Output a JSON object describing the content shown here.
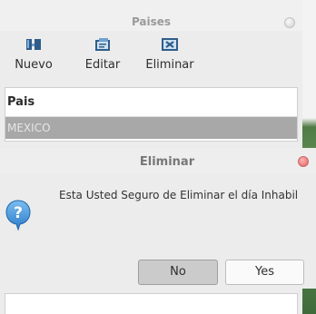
{
  "window": {
    "title": "Paises"
  },
  "toolbar": {
    "nuevo_label": "Nuevo",
    "editar_label": "Editar",
    "eliminar_label": "Eliminar",
    "nuevo_icon": "new-record-icon",
    "editar_icon": "edit-record-icon",
    "eliminar_icon": "delete-record-icon"
  },
  "table": {
    "column_header": "Pais",
    "rows": [
      "MEXICO"
    ]
  },
  "dialog": {
    "title": "Eliminar",
    "message": "Esta Usted Seguro de Eliminar el día Inhabil",
    "icon": "question-icon",
    "no_label": "No",
    "yes_label": "Yes"
  },
  "colors": {
    "selected_row": "#a8a8a8",
    "question_icon": "#3d8fd6",
    "dialog_close": "#e06060"
  }
}
